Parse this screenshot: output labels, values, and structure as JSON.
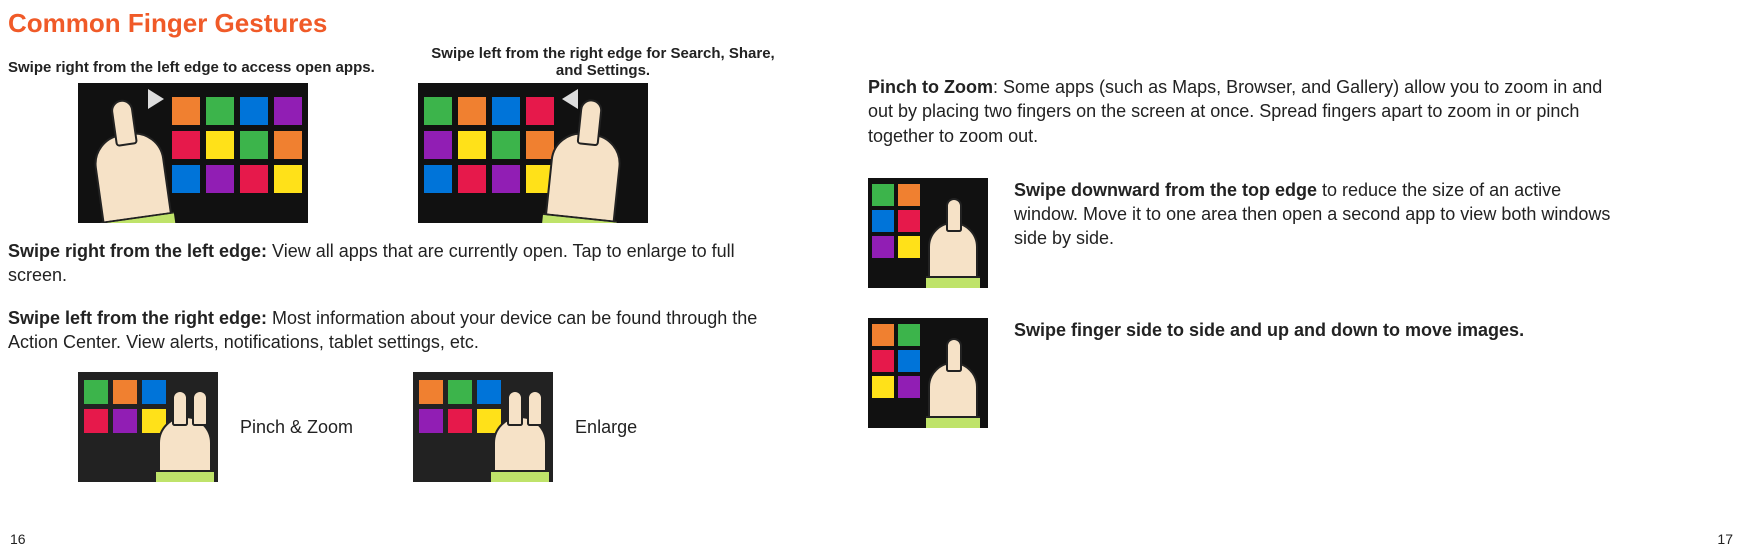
{
  "title": "Common Finger Gestures",
  "left": {
    "caption1": "Swipe right from the left edge to access open apps.",
    "caption2": "Swipe left from the right edge for Search, Share, and Settings.",
    "para1_bold": "Swipe right from the left edge:",
    "para1_rest": " View all apps that are currently open. Tap to enlarge to full screen.",
    "para2_bold": "Swipe left from the right edge:",
    "para2_rest": " Most information about your device can be found through the Action Center. View alerts, notifications, tablet settings, etc.",
    "pair1_label": "Pinch & Zoom",
    "pair2_label": "Enlarge"
  },
  "right": {
    "pinch_bold": "Pinch to Zoom",
    "pinch_rest": ": Some apps (such as Maps, Browser, and Gallery) allow you to zoom in and out by placing two fingers on the screen at once. Spread fingers apart to zoom in or pinch together to zoom out.",
    "swipe_down_bold": "Swipe downward from the top edge",
    "swipe_down_rest": " to reduce the size of an active window. Move it to one area then open a second app to view both windows side by side.",
    "swipe_side_bold": "Swipe finger side to side and up and down to move images."
  },
  "page_left": "16",
  "page_right": "17"
}
